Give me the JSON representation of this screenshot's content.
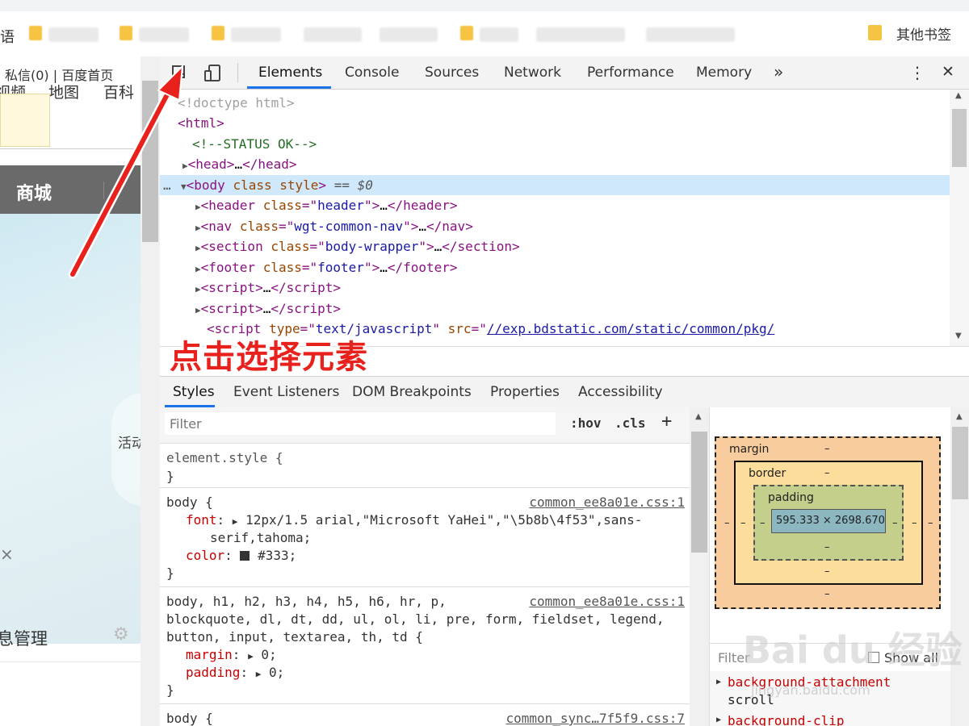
{
  "bookmarks_bar": {
    "first_fragment": "语",
    "other_bookmarks": "其他书签"
  },
  "left_page": {
    "top_links": "私信(0) | 百度首页",
    "nav_items": [
      "视频",
      "地图",
      "百科"
    ],
    "banner_label": "商城",
    "hero_text": "活动",
    "close_symbol": "×",
    "bottom_item": "息管理"
  },
  "devtools": {
    "tabs": [
      "Elements",
      "Console",
      "Sources",
      "Network",
      "Performance",
      "Memory"
    ],
    "active_tab": "Elements",
    "more_tabs": "»",
    "menu_icon": "⋮",
    "close_icon": "✕",
    "elements_tree": {
      "doctype": "<!doctype html>",
      "html_open": "<html>",
      "comment": "<!--STATUS OK-->",
      "head_tag": "head",
      "body_line": {
        "tag": "body",
        "attrs": "class style",
        "suffix": "== $0"
      },
      "children": [
        {
          "tag": "header",
          "attr": "class",
          "value": "header"
        },
        {
          "tag": "nav",
          "attr": "class",
          "value": "wgt-common-nav"
        },
        {
          "tag": "section",
          "attr": "class",
          "value": "body-wrapper"
        },
        {
          "tag": "footer",
          "attr": "class",
          "value": "footer"
        }
      ],
      "script_tag": "script",
      "script_line": {
        "type_attr": "type",
        "type_value": "text/javascript",
        "src_attr": "src",
        "src_value": "//exp.bdstatic.com/static/common/pkg/"
      }
    },
    "sub_tabs": [
      "Styles",
      "Event Listeners",
      "DOM Breakpoints",
      "Properties",
      "Accessibility"
    ],
    "active_sub_tab": "Styles",
    "styles": {
      "filter_placeholder": "Filter",
      "hov_label": ":hov",
      "cls_label": ".cls",
      "add_label": "+",
      "rules": [
        {
          "selector": "element.style {",
          "close": "}"
        },
        {
          "selector": "body {",
          "source": "common_ee8a01e.css:1",
          "font_prop": "font",
          "font_value_1": "12px/1.5 arial,\"Microsoft YaHei\",\"\\5b8b\\4f53\",sans-",
          "font_value_2": "serif,tahoma;",
          "color_prop": "color",
          "color_value": "#333;",
          "close": "}"
        },
        {
          "selector_1": "body, h1, h2, h3, h4, h5, h6, hr, p,",
          "source": "common_ee8a01e.css:1",
          "selector_2": "blockquote, dl, dt, dd, ul, ol, li, pre, form, fieldset, legend,",
          "selector_3": "button, input, textarea, th, td {",
          "margin_prop": "margin",
          "margin_value": "0;",
          "padding_prop": "padding",
          "padding_value": "0;",
          "close": "}"
        },
        {
          "selector": "body {",
          "source": "common_sync…7f5f9.css:7"
        }
      ]
    },
    "box_model": {
      "margin_label": "margin",
      "border_label": "border",
      "padding_label": "padding",
      "content_size": "595.333 × 2698.670",
      "dash": "–",
      "colors": {
        "margin": "#f9cc9d",
        "border": "#fddd9b",
        "padding": "#c3cf8a",
        "content": "#8cb6c0"
      }
    },
    "computed": {
      "filter_placeholder": "Filter",
      "show_all": "Show all",
      "props": [
        {
          "name": "background-attachment",
          "value": "scroll"
        },
        {
          "name": "background-clip",
          "value": ""
        }
      ]
    }
  },
  "annotation": {
    "text": "点击选择元素",
    "color": "#e8211d"
  },
  "watermark": {
    "text": "Bai du 经验",
    "sub": "jingyan.baidu.com"
  }
}
